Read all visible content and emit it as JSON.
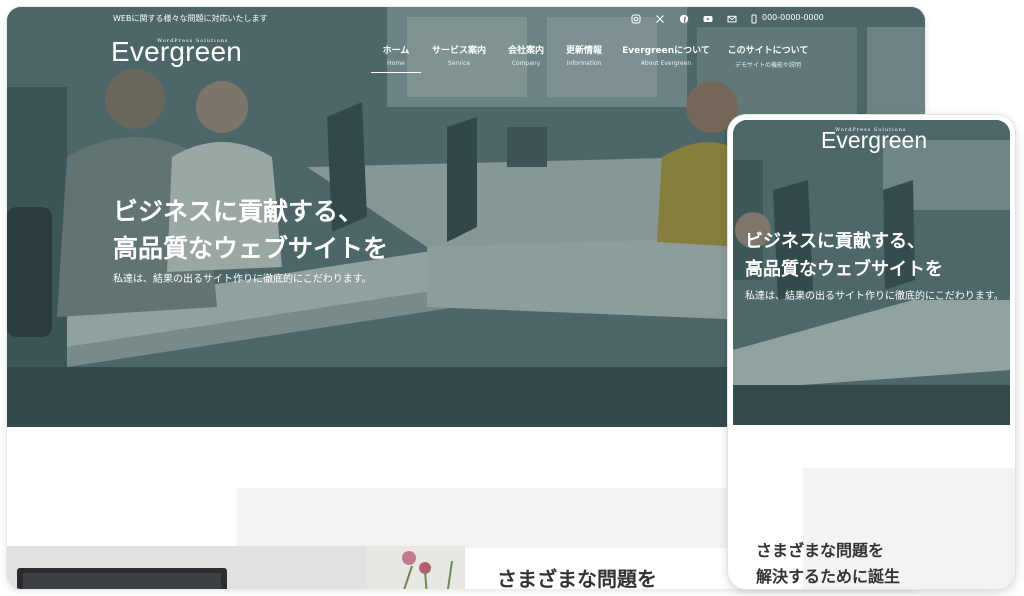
{
  "header": {
    "tagline": "WEBに関する様々な問題に対応いたします",
    "phone": "000-0000-0000",
    "social_icons": [
      "instagram-icon",
      "x-icon",
      "facebook-icon",
      "youtube-icon",
      "mail-icon",
      "phone-icon"
    ]
  },
  "logo": {
    "text": "Evergreen",
    "subtext": "WordPress Solutions"
  },
  "nav": {
    "items": [
      {
        "label": "ホーム",
        "sub": "Home"
      },
      {
        "label": "サービス案内",
        "sub": "Service"
      },
      {
        "label": "会社案内",
        "sub": "Company"
      },
      {
        "label": "更新情報",
        "sub": "Information"
      },
      {
        "label": "Evergreenについて",
        "sub": "About Evergreen"
      },
      {
        "label": "このサイトについて",
        "sub": "デモサイトの機能や説明"
      }
    ]
  },
  "hero": {
    "headline_line1": "ビジネスに貢献する、",
    "headline_line2": "高品質なウェブサイトを",
    "subline": "私達は、結果の出るサイト作りに徹底的にこだわります。"
  },
  "section": {
    "title_line1": "さまざまな問題を",
    "title_line2": "解決するために誕生"
  },
  "colors": {
    "overlay": "#4f6b6b",
    "heading_text": "#333333",
    "panel": "#f3f3f3"
  }
}
